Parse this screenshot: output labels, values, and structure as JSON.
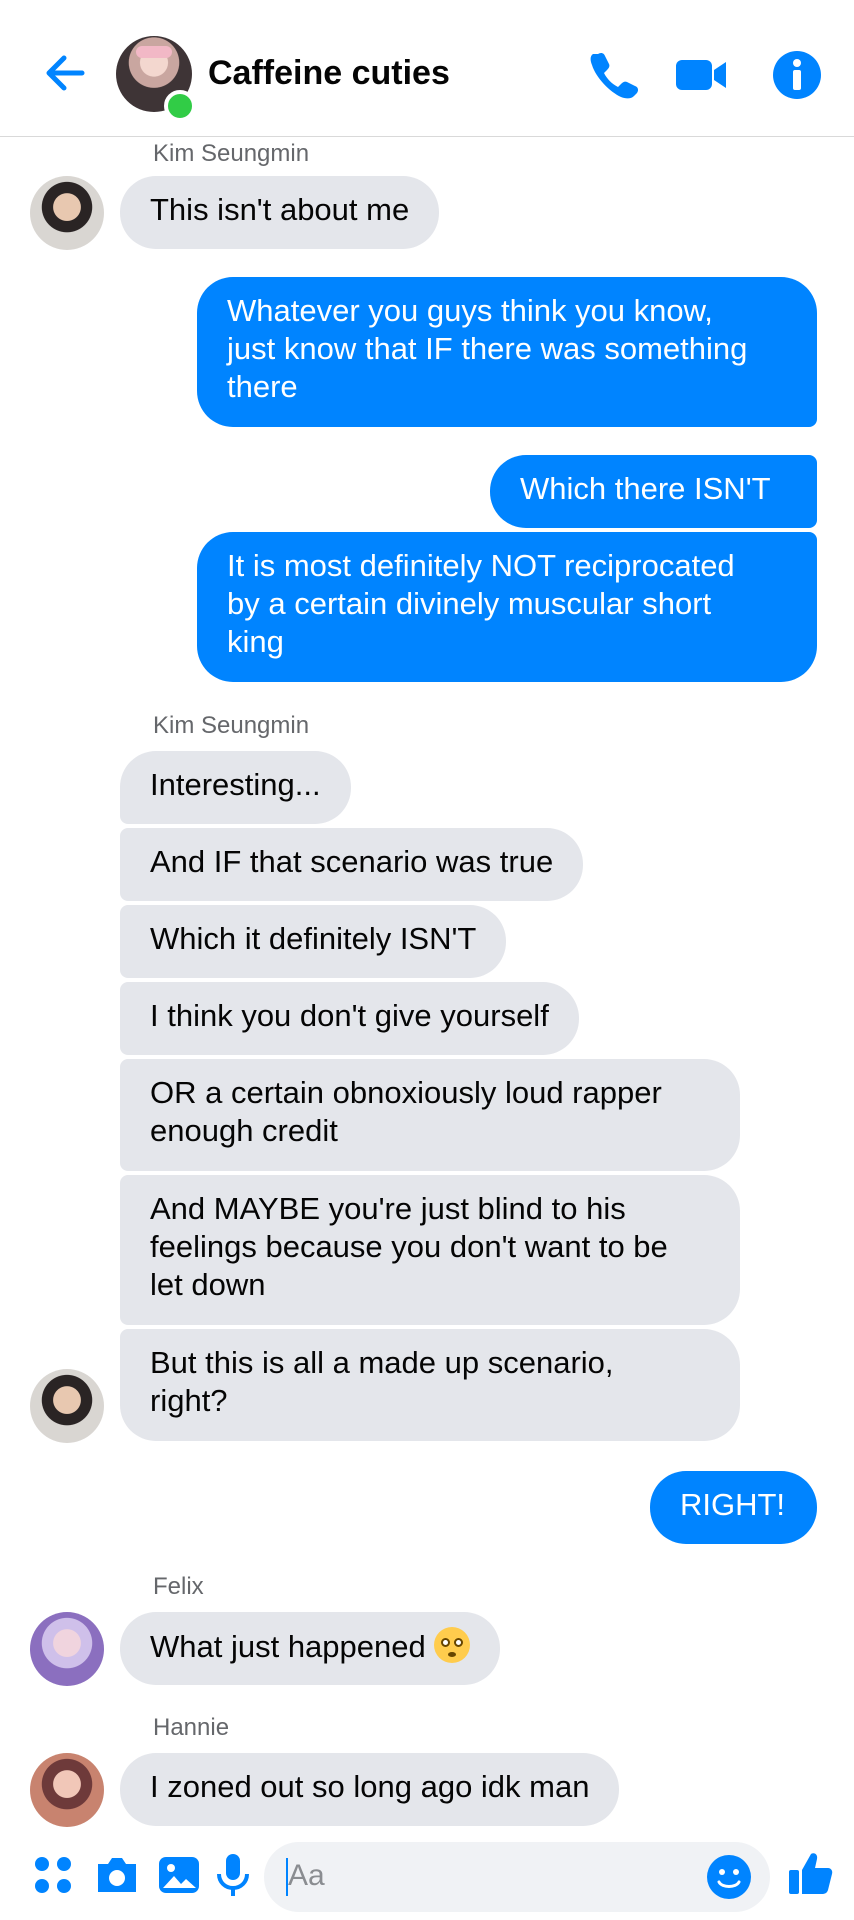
{
  "header": {
    "title": "Caffeine cuties",
    "icons": [
      "back-arrow-icon",
      "group-avatar",
      "phone-icon",
      "video-camera-icon",
      "info-icon"
    ]
  },
  "colors": {
    "accent": "#0084ff",
    "incoming_bubble": "#e4e6eb",
    "online": "#31cc46"
  },
  "messages": {
    "s1_sender": "Kim Seungmin",
    "m1": "This isn't about me",
    "m2": "Whatever you guys think you know,\njust know that IF there was something\nthere",
    "m3": "Which there ISN'T",
    "m4": "It is most definitely NOT reciprocated\nby a certain divinely muscular short\nking",
    "s2_sender": "Kim Seungmin",
    "m5": "Interesting...",
    "m6": "And IF that scenario was true",
    "m7": "Which it definitely ISN'T",
    "m8": "I think you don't give yourself",
    "m9": "OR a certain obnoxiously loud rapper\nenough credit",
    "m10": "And MAYBE you're just blind to his\nfeelings because you don't want to be\nlet down",
    "m11": "But this is all a made up scenario,\nright?",
    "m12": "RIGHT!",
    "s3_sender": "Felix",
    "m13": "What just happened",
    "m13_emoji": "flushed-face-emoji",
    "s4_sender": "Hannie",
    "m14": "I zoned out so long ago idk man"
  },
  "composer": {
    "placeholder": "Aa",
    "icons": [
      "apps-icon",
      "camera-icon",
      "gallery-icon",
      "microphone-icon",
      "emoji-icon",
      "thumbs-up-icon"
    ]
  }
}
